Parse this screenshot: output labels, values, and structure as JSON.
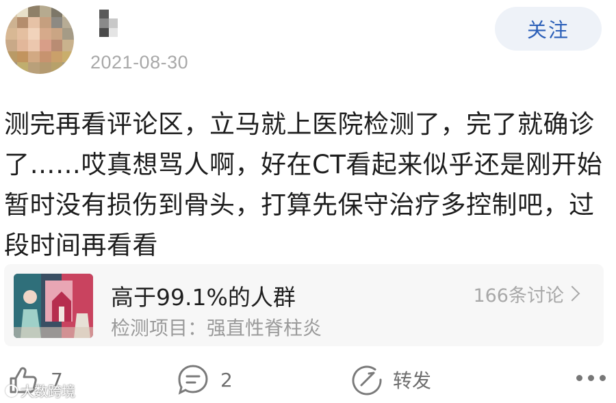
{
  "post": {
    "date": "2021-08-30",
    "follow_label": "关注",
    "body": "测完再看评论区，立马就上医院检测了，完了就确诊了……哎真想骂人啊，好在CT看起来似乎还是刚开始暂时没有损伤到骨头，打算先保守治疗多控制吧，过段时间再看看"
  },
  "card": {
    "title": "高于99.1%的人群",
    "subtitle": "检测项目：强直性脊柱炎",
    "discussion": "166条讨论"
  },
  "actions": {
    "like_count": "7",
    "comment_count": "2",
    "repost_label": "转发"
  },
  "watermark": {
    "text": "大数跨境"
  },
  "colors": {
    "accent": "#2b5fb8",
    "follow_bg": "#eef2f8",
    "card_bg": "#f7f7f7"
  },
  "icons": [
    "like-icon",
    "comment-icon",
    "repost-icon",
    "more-icon",
    "chevron-right-icon"
  ]
}
